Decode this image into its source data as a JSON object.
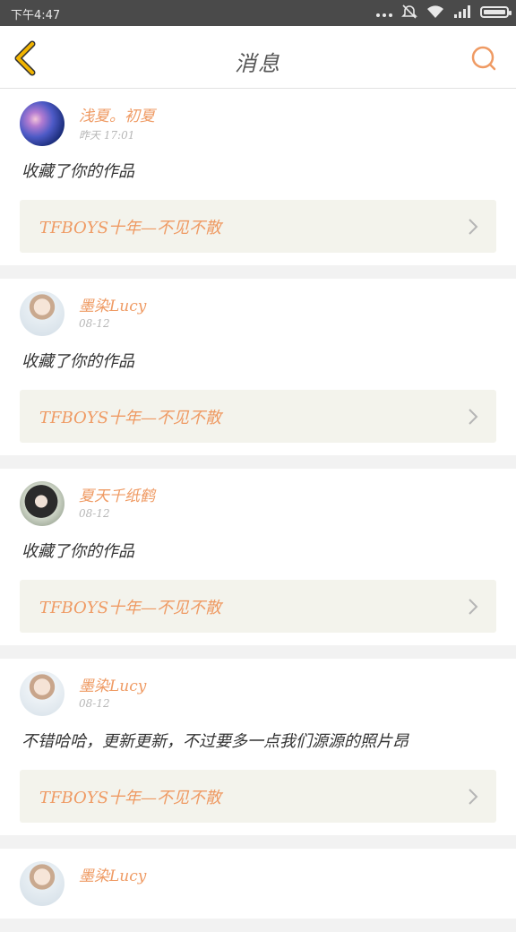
{
  "status_bar": {
    "time": "下午4:47",
    "icons": [
      "more-dots-icon",
      "dnd-icon",
      "wifi-icon",
      "signal-icon",
      "battery-icon"
    ]
  },
  "header": {
    "title": "消息",
    "back_icon": "back-chevron-icon",
    "search_icon": "search-icon"
  },
  "colors": {
    "accent": "#ef9a63",
    "back": "#f1b400",
    "work_bg": "#f3f3ec"
  },
  "messages": [
    {
      "name": "浅夏。初夏",
      "time": "昨天 17:01",
      "text": "收藏了你的作品",
      "work_title": "TFBOYS十年—不见不散",
      "avatar": "galaxy-avatar"
    },
    {
      "name": "墨染Lucy",
      "time": "08-12",
      "text": "收藏了你的作品",
      "work_title": "TFBOYS十年—不见不散",
      "avatar": "girl-avatar"
    },
    {
      "name": "夏天千纸鹤",
      "time": "08-12",
      "text": "收藏了你的作品",
      "work_title": "TFBOYS十年—不见不散",
      "avatar": "anime-girl-avatar"
    },
    {
      "name": "墨染Lucy",
      "time": "08-12",
      "text": "不错哈哈，更新更新，不过要多一点我们源源的照片昂",
      "work_title": "TFBOYS十年—不见不散",
      "avatar": "girl-avatar"
    },
    {
      "name": "墨染Lucy",
      "avatar": "girl-avatar"
    }
  ]
}
